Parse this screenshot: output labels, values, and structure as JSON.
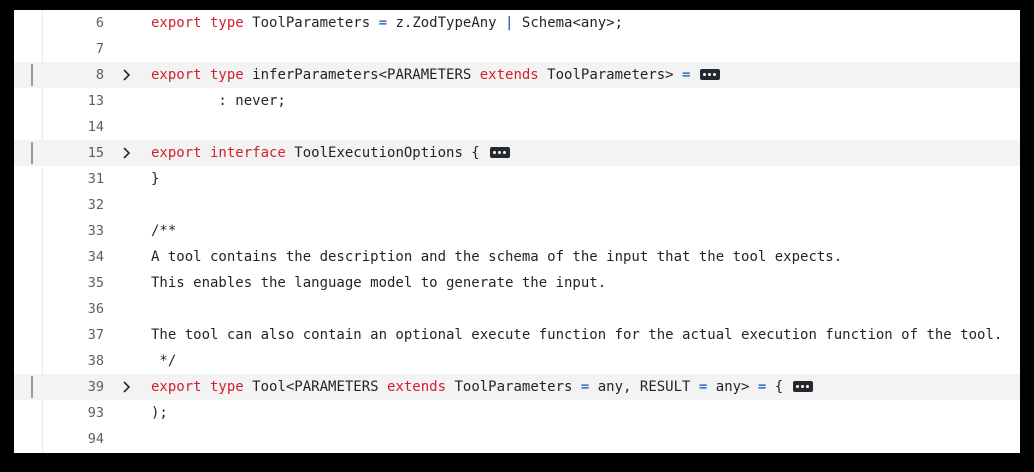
{
  "lines": [
    {
      "n": "6",
      "tokens": [
        {
          "t": "export type ",
          "c": "kw"
        },
        {
          "t": "ToolParameters ",
          "c": "pl"
        },
        {
          "t": "=",
          "c": "op"
        },
        {
          "t": " z.ZodTypeAny ",
          "c": "pl"
        },
        {
          "t": "|",
          "c": "op"
        },
        {
          "t": " Schema<any>;",
          "c": "pl"
        }
      ]
    },
    {
      "n": "7",
      "tokens": []
    },
    {
      "n": "8",
      "folded": true,
      "tokens": [
        {
          "t": "export type ",
          "c": "kw"
        },
        {
          "t": "inferParameters<PARAMETERS ",
          "c": "pl"
        },
        {
          "t": "extends",
          "c": "kw"
        },
        {
          "t": " ToolParameters> ",
          "c": "pl"
        },
        {
          "t": "=",
          "c": "op"
        }
      ]
    },
    {
      "n": "13",
      "tokens": [
        {
          "t": "        : never;",
          "c": "pl"
        }
      ]
    },
    {
      "n": "14",
      "tokens": []
    },
    {
      "n": "15",
      "folded": true,
      "tokens": [
        {
          "t": "export interface ",
          "c": "kw"
        },
        {
          "t": "ToolExecutionOptions {",
          "c": "pl"
        }
      ]
    },
    {
      "n": "31",
      "tokens": [
        {
          "t": "}",
          "c": "pl"
        }
      ]
    },
    {
      "n": "32",
      "tokens": []
    },
    {
      "n": "33",
      "tokens": [
        {
          "t": "/**",
          "c": "cm"
        }
      ]
    },
    {
      "n": "34",
      "tokens": [
        {
          "t": "A tool contains the description and the schema of the input that the tool expects.",
          "c": "cm"
        }
      ]
    },
    {
      "n": "35",
      "tokens": [
        {
          "t": "This enables the language model to generate the input.",
          "c": "cm"
        }
      ]
    },
    {
      "n": "36",
      "tokens": []
    },
    {
      "n": "37",
      "tokens": [
        {
          "t": "The tool can also contain an optional execute function for the actual execution function of the tool.",
          "c": "cm"
        }
      ]
    },
    {
      "n": "38",
      "tokens": [
        {
          "t": " */",
          "c": "cm"
        }
      ]
    },
    {
      "n": "39",
      "folded": true,
      "tokens": [
        {
          "t": "export type ",
          "c": "kw"
        },
        {
          "t": "Tool<PARAMETERS ",
          "c": "pl"
        },
        {
          "t": "extends",
          "c": "kw"
        },
        {
          "t": " ToolParameters ",
          "c": "pl"
        },
        {
          "t": "=",
          "c": "op"
        },
        {
          "t": " any, RESULT ",
          "c": "pl"
        },
        {
          "t": "=",
          "c": "op"
        },
        {
          "t": " any> ",
          "c": "pl"
        },
        {
          "t": "=",
          "c": "op"
        },
        {
          "t": " {",
          "c": "pl"
        }
      ]
    },
    {
      "n": "93",
      "tokens": [
        {
          "t": ");",
          "c": "pl"
        }
      ]
    },
    {
      "n": "94",
      "tokens": []
    }
  ],
  "icons": {
    "fold": "chevron-right-icon",
    "collapsed": "ellipsis-icon"
  },
  "colors": {
    "keyword": "#cf222e",
    "operator": "#0550ae",
    "text": "#1f2328",
    "line_number": "#57606a",
    "folded_background": "#f3f3f3"
  }
}
